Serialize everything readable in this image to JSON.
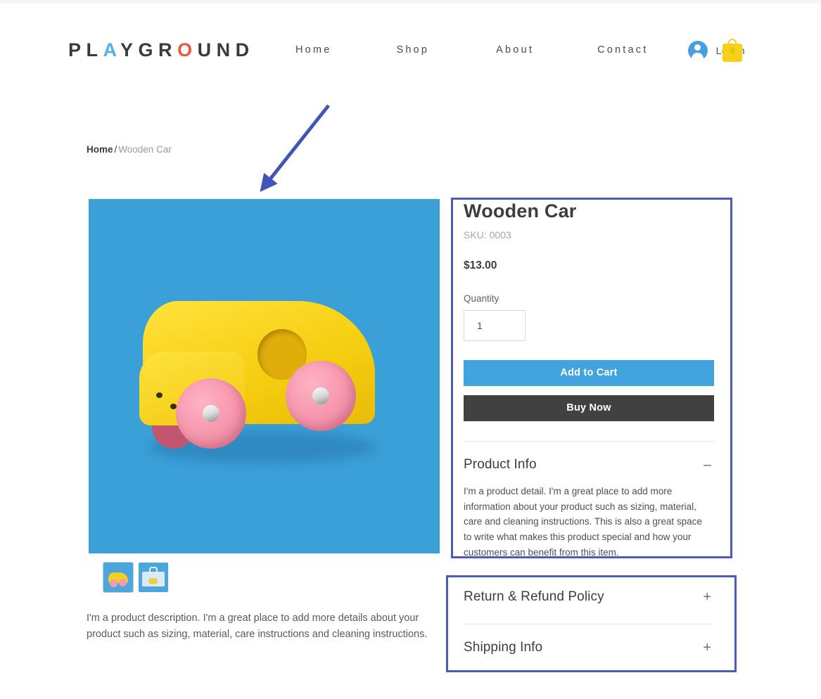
{
  "header": {
    "logo_text": "PLAYGROUND",
    "logo_parts": {
      "p1": "PL",
      "a": "A",
      "p2": "YGR",
      "o": "O",
      "p3": "UND"
    },
    "nav": [
      {
        "label": "Home",
        "name": "nav-home"
      },
      {
        "label": "Shop",
        "name": "nav-shop"
      },
      {
        "label": "About",
        "name": "nav-about"
      },
      {
        "label": "Contact",
        "name": "nav-contact"
      }
    ],
    "login_label": "Log In",
    "cart_count": "0",
    "avatar_icon": "user-avatar-icon",
    "cart_icon": "shopping-bag-icon"
  },
  "breadcrumb": {
    "home": "Home",
    "separator": "/",
    "current": "Wooden Car"
  },
  "gallery": {
    "main_image_alt": "Wooden Car toy on blue background",
    "thumbnails": [
      {
        "name": "thumbnail-car",
        "alt": "Yellow wooden car with pink wheels",
        "selected": true
      },
      {
        "name": "thumbnail-box",
        "alt": "Toy storage case with wooden car inside",
        "selected": false
      }
    ]
  },
  "product": {
    "title": "Wooden Car",
    "sku": "SKU: 0003",
    "price": "$13.00",
    "quantity_label": "Quantity",
    "quantity_value": "1",
    "add_to_cart_label": "Add to Cart",
    "buy_now_label": "Buy Now",
    "description": "I'm a product description. I'm a great place to add more details about your product such as sizing, material, care instructions and cleaning instructions."
  },
  "accordions": [
    {
      "title": "Product Info",
      "sign": "–",
      "expanded": true,
      "body": "I'm a product detail. I'm a great place to add more information about your product such as sizing, material, care and cleaning instructions. This is also a great space to write what makes this product special and how your customers can benefit from this item."
    },
    {
      "title": "Return & Refund Policy",
      "sign": "+",
      "expanded": false,
      "body": ""
    },
    {
      "title": "Shipping Info",
      "sign": "+",
      "expanded": false,
      "body": ""
    }
  ],
  "colors": {
    "accent_blue": "#41a4de",
    "buy_now_dark": "#414141",
    "logo_blue": "#4fb3e8",
    "logo_red": "#e8563f",
    "cart_yellow": "#f7d117",
    "image_background": "#3b9fd8",
    "annotation_blue": "#4a5cb8"
  },
  "annotations": {
    "arrow": {
      "name": "annotation-arrow",
      "color": "#4a5cb8"
    },
    "box_1": {
      "name": "annotation-box-product-panel",
      "color": "#4a5cb8"
    },
    "box_2": {
      "name": "annotation-box-lower-accordions",
      "color": "#4a5cb8"
    }
  }
}
